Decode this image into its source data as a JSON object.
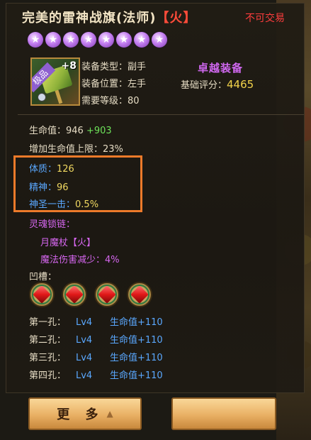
{
  "item": {
    "name": "完美的雷神战旗(法师)",
    "element_tag": "【火】",
    "trade_status": "不可交易",
    "stars": [
      "★",
      "★",
      "★",
      "★",
      "★",
      "★",
      "★",
      "★"
    ],
    "icon": {
      "quality_badge": "极品",
      "enhance_level": "+8"
    },
    "type_label": "装备类型：副手",
    "slot_label": "装备位置：左手",
    "level_label": "需要等级：80",
    "rarity": "卓越装备",
    "score_label": "基础评分：",
    "score_value": "4465"
  },
  "stats": {
    "hp_label": "生命值：946",
    "hp_bonus": "+903",
    "hp_max_label": "增加生命值上限：23%"
  },
  "highlighted_stats": {
    "constitution_label": "体质：",
    "constitution_value": "126",
    "spirit_label": "精神：",
    "spirit_value": "96",
    "holy_strike_label": "神圣一击：",
    "holy_strike_value": "0.5%"
  },
  "soul_chain": {
    "title": "灵魂锁链：",
    "item": "月魔杖【火】",
    "effect": "魔法伤害减少：4%"
  },
  "slots": {
    "title": "凹槽：",
    "gems": [
      "red-gem",
      "red-gem",
      "red-gem",
      "red-gem"
    ],
    "holes": [
      {
        "label": "第一孔：",
        "level": "Lv4",
        "bonus": "生命值+110"
      },
      {
        "label": "第二孔：",
        "level": "Lv4",
        "bonus": "生命值+110"
      },
      {
        "label": "第三孔：",
        "level": "Lv4",
        "bonus": "生命值+110"
      },
      {
        "label": "第四孔：",
        "level": "Lv4",
        "bonus": "生命值+110"
      }
    ]
  },
  "buttons": {
    "more_label": "更 多",
    "more_icon": "chevron-up-icon"
  },
  "colors": {
    "highlight_box": "#ec7a2a",
    "rarity": "#d068f0",
    "stat_blue": "#5aa8ff",
    "stat_green": "#6ee35a",
    "score_gold": "#f2d24a"
  }
}
